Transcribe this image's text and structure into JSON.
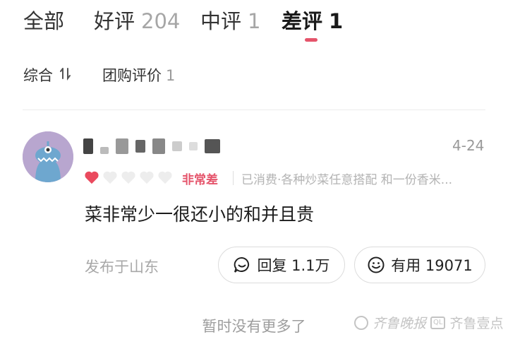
{
  "tabs": [
    {
      "label": "全部",
      "count": ""
    },
    {
      "label": "好评",
      "count": "204"
    },
    {
      "label": "中评",
      "count": "1"
    },
    {
      "label": "差评",
      "count": "1"
    }
  ],
  "active_tab_index": 3,
  "subtabs": [
    {
      "label": "综合",
      "icon": "sort-icon"
    },
    {
      "label": "团购评价",
      "count": "1"
    }
  ],
  "review": {
    "date": "4-24",
    "rating_stars": 1,
    "rating_max": 5,
    "rating_label": "非常差",
    "meta": "已消费·各种炒菜任意搭配 和一份香米...",
    "content": "菜非常少一很还小的和并且贵",
    "location": "发布于山东",
    "reply_label": "回复 1.1万",
    "useful_label": "有用 19071"
  },
  "footer": {
    "no_more": "暂时没有更多了",
    "watermark_text": "齐鲁晚报",
    "watermark_brand": "齐鲁壹点"
  },
  "colors": {
    "accent": "#e5546b",
    "muted_text": "#a6a6a6",
    "avatar_bg": "#b8a6cf"
  }
}
